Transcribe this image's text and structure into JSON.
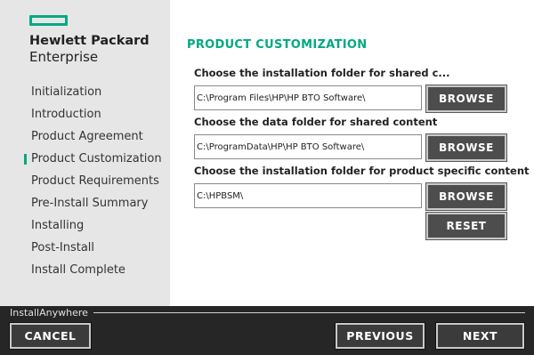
{
  "brand": {
    "company_line1": "Hewlett Packard",
    "company_line2": "Enterprise",
    "accent_color": "#01a982"
  },
  "sidebar": {
    "steps": [
      {
        "label": "Initialization"
      },
      {
        "label": "Introduction"
      },
      {
        "label": "Product Agreement"
      },
      {
        "label": "Product Customization",
        "active": true
      },
      {
        "label": "Product Requirements"
      },
      {
        "label": "Pre-Install Summary"
      },
      {
        "label": "Installing"
      },
      {
        "label": "Post-Install"
      },
      {
        "label": "Install Complete"
      }
    ]
  },
  "main": {
    "title": "PRODUCT CUSTOMIZATION",
    "fields": [
      {
        "label": "Choose the installation folder for shared c...",
        "value": "C:\\Program Files\\HP\\HP BTO Software\\",
        "button": "BROWSE"
      },
      {
        "label": "Choose the data folder for shared content",
        "value": "C:\\ProgramData\\HP\\HP BTO Software\\",
        "button": "BROWSE"
      },
      {
        "label": "Choose the installation folder for product specific content",
        "value": "C:\\HPBSM\\",
        "button": "BROWSE"
      }
    ],
    "reset_label": "RESET"
  },
  "footer": {
    "installer_name": "InstallAnywhere",
    "cancel_label": "CANCEL",
    "previous_label": "PREVIOUS",
    "next_label": "NEXT"
  }
}
